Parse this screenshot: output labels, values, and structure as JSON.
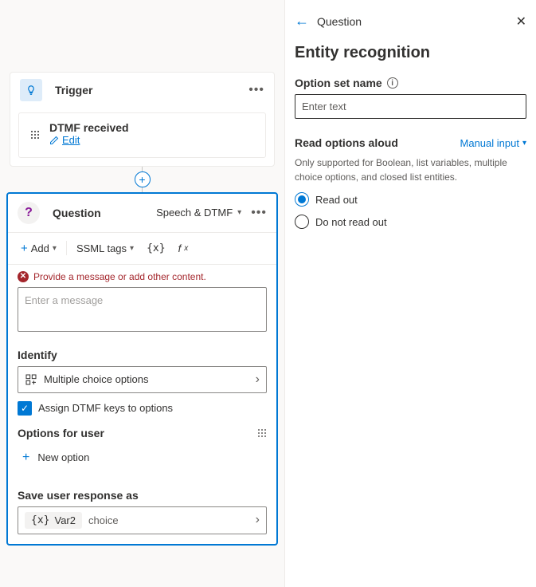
{
  "trigger": {
    "title": "Trigger",
    "item": {
      "title": "DTMF received",
      "editLabel": "Edit"
    }
  },
  "question": {
    "title": "Question",
    "delivery": "Speech & DTMF",
    "toolbar": {
      "add": "Add",
      "ssml": "SSML tags",
      "var": "{x}",
      "fx": "fx"
    },
    "error": "Provide a message or add other content.",
    "messagePlaceholder": "Enter a message",
    "identify": {
      "label": "Identify",
      "value": "Multiple choice options"
    },
    "assignDtmf": {
      "checked": true,
      "label": "Assign DTMF keys to options"
    },
    "optionsLabel": "Options for user",
    "newOption": "New option",
    "saveAs": {
      "label": "Save user response as",
      "varName": "Var2",
      "varType": "choice"
    }
  },
  "panel": {
    "breadcrumb": "Question",
    "title": "Entity recognition",
    "optionSet": {
      "label": "Option set name",
      "placeholder": "Enter text"
    },
    "readAloud": {
      "label": "Read options aloud",
      "mode": "Manual input",
      "help": "Only supported for Boolean, list variables, multiple choice options, and closed list entities.",
      "opt1": "Read out",
      "opt2": "Do not read out",
      "selected": "opt1"
    }
  }
}
